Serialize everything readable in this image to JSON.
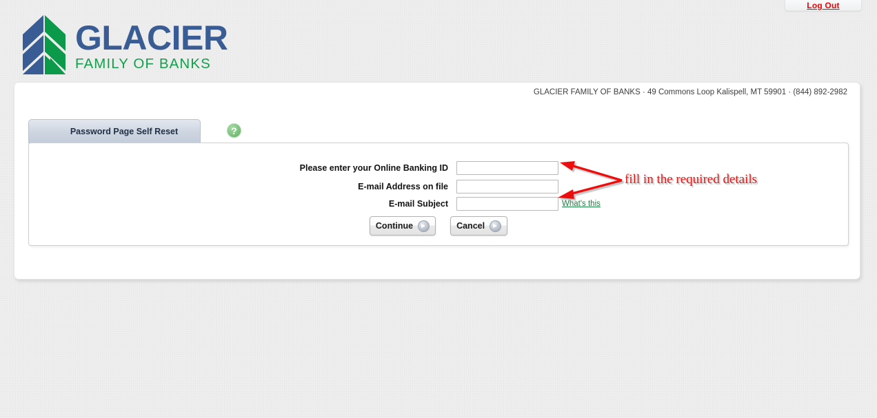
{
  "window": {
    "logout_label": "Log Out"
  },
  "brand": {
    "name_main": "GLACIER",
    "name_main_first": "G",
    "name_main_rest": "LACIER",
    "name_sub": "FAMILY OF BANKS",
    "logo_icon": "glacier-mountain-logo",
    "blue": "#3a5c94",
    "green": "#10a14b"
  },
  "panel": {
    "address_line": "GLACIER FAMILY OF BANKS  ·  49 Commons Loop Kalispell, MT 59901  ·  (844) 892-2982"
  },
  "tabs": [
    {
      "label": "Password Page Self Reset",
      "active": true
    }
  ],
  "help": {
    "icon": "question-mark-icon",
    "glyph": "?"
  },
  "form": {
    "fields": [
      {
        "label": "Please enter your Online Banking ID",
        "value": "",
        "placeholder": ""
      },
      {
        "label": "E-mail Address on file",
        "value": "",
        "placeholder": ""
      },
      {
        "label": "E-mail Subject",
        "value": "",
        "placeholder": ""
      }
    ],
    "whats_this_label": "What's this",
    "buttons": [
      {
        "label": "Continue",
        "icon": "arrow-right-circle-icon"
      },
      {
        "label": "Cancel",
        "icon": "arrow-right-circle-icon"
      }
    ]
  },
  "annotation": {
    "text": "fill in the required details",
    "color": "#ee1111",
    "arrows": 2
  }
}
